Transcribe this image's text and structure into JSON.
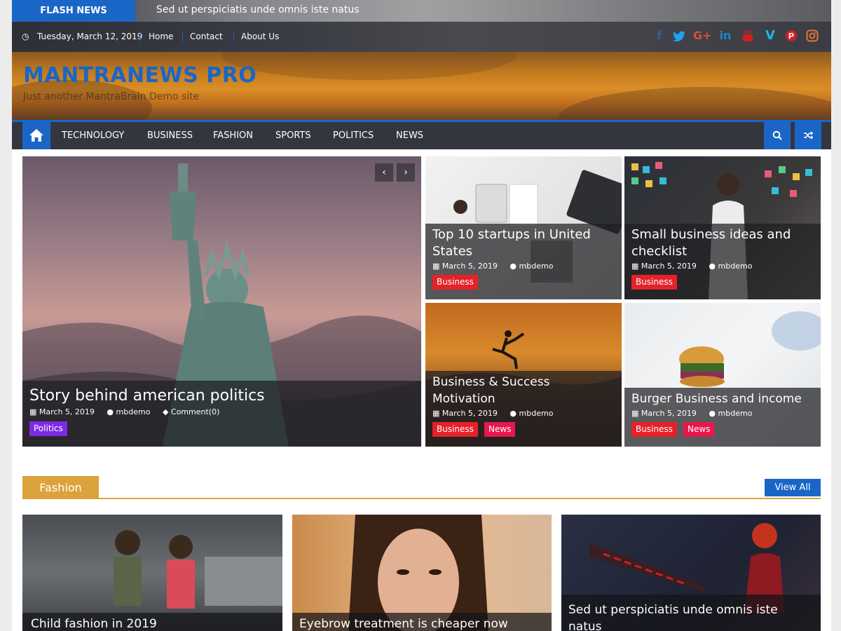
{
  "flash": {
    "label": "FLASH NEWS",
    "headline": "Sed ut perspiciatis unde omnis iste natus"
  },
  "topbar": {
    "date": "Tuesday, March 12, 2019",
    "links": [
      "Home",
      "Contact",
      "About Us"
    ],
    "social": [
      {
        "name": "facebook-icon",
        "glyph": "f",
        "color": "#3b5998"
      },
      {
        "name": "twitter-icon",
        "glyph": "t",
        "color": "#1da1f2"
      },
      {
        "name": "google-plus-icon",
        "glyph": "G+",
        "color": "#dd4b39"
      },
      {
        "name": "linkedin-icon",
        "glyph": "in",
        "color": "#1b86c7"
      },
      {
        "name": "youtube-icon",
        "glyph": "▶",
        "color": "#cd201f"
      },
      {
        "name": "vimeo-icon",
        "glyph": "V",
        "color": "#1ab7ea"
      },
      {
        "name": "pinterest-icon",
        "glyph": "P",
        "color": "#cb2027"
      },
      {
        "name": "instagram-icon",
        "glyph": "◎",
        "color": "#e8703a"
      }
    ]
  },
  "site": {
    "title": "MANTRANEWS PRO",
    "tagline": "Just another MantraBrain Demo site"
  },
  "nav": {
    "items": [
      "TECHNOLOGY",
      "BUSINESS",
      "FASHION",
      "SPORTS",
      "POLITICS",
      "NEWS"
    ]
  },
  "featured": {
    "main": {
      "title": "Story behind american politics",
      "date": "March 5, 2019",
      "author": "mbdemo",
      "comments": "Comment(0)",
      "tags": [
        "Politics"
      ]
    },
    "grid": [
      {
        "title": "Top 10 startups in United States",
        "date": "March 5, 2019",
        "author": "mbdemo",
        "tags": [
          "Business"
        ]
      },
      {
        "title": "Small business ideas and checklist",
        "date": "March 5, 2019",
        "author": "mbdemo",
        "tags": [
          "Business"
        ]
      },
      {
        "title": "Business & Success Motivation",
        "date": "March 5, 2019",
        "author": "mbdemo",
        "tags": [
          "Business",
          "News"
        ]
      },
      {
        "title": "Burger Business and income",
        "date": "March 5, 2019",
        "author": "mbdemo",
        "tags": [
          "Business",
          "News"
        ]
      }
    ]
  },
  "fashion": {
    "title": "Fashion",
    "view_all": "View All",
    "posts": [
      {
        "title": "Child fashion in 2019"
      },
      {
        "title": "Eyebrow treatment is cheaper now"
      },
      {
        "title": "Sed ut perspiciatis unde omnis iste natus"
      }
    ]
  },
  "colors": {
    "accent": "#1a66c7",
    "fashion": "#dca23b",
    "business": "#e52129",
    "news": "#e8174e",
    "politics": "#7c2be6",
    "nav_bg": "#34363f"
  }
}
